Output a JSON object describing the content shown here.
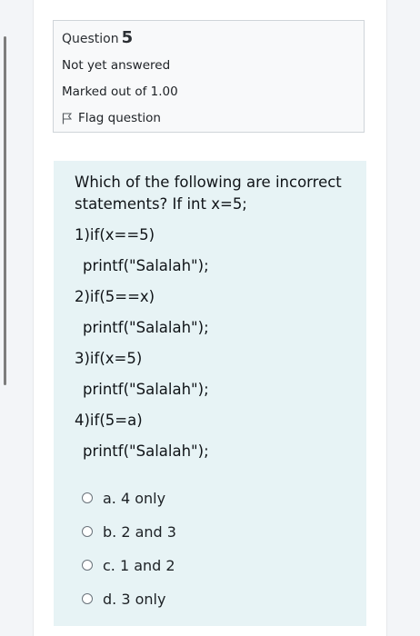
{
  "question_info": {
    "question_label": "Question",
    "question_number": "5",
    "status": "Not yet answered",
    "marked_out_of": "Marked out of 1.00",
    "flag_label": "Flag question"
  },
  "question": {
    "stem_line1": "Which of the following are incorrect",
    "stem_line2": "statements? If int x=5;",
    "code_lines": [
      "1)if(x==5)",
      "printf(\"Salalah\");",
      "2)if(5==x)",
      "printf(\"Salalah\");",
      "3)if(x=5)",
      "printf(\"Salalah\");",
      "4)if(5=a)",
      "printf(\"Salalah\");"
    ]
  },
  "answers": [
    {
      "label": "a. 4 only"
    },
    {
      "label": "b. 2 and 3"
    },
    {
      "label": "c. 1 and 2"
    },
    {
      "label": "d. 3 only"
    }
  ],
  "colors": {
    "info_bg": "#f8f9fa",
    "content_bg": "#e7f3f5",
    "border": "#cfd4d9"
  }
}
